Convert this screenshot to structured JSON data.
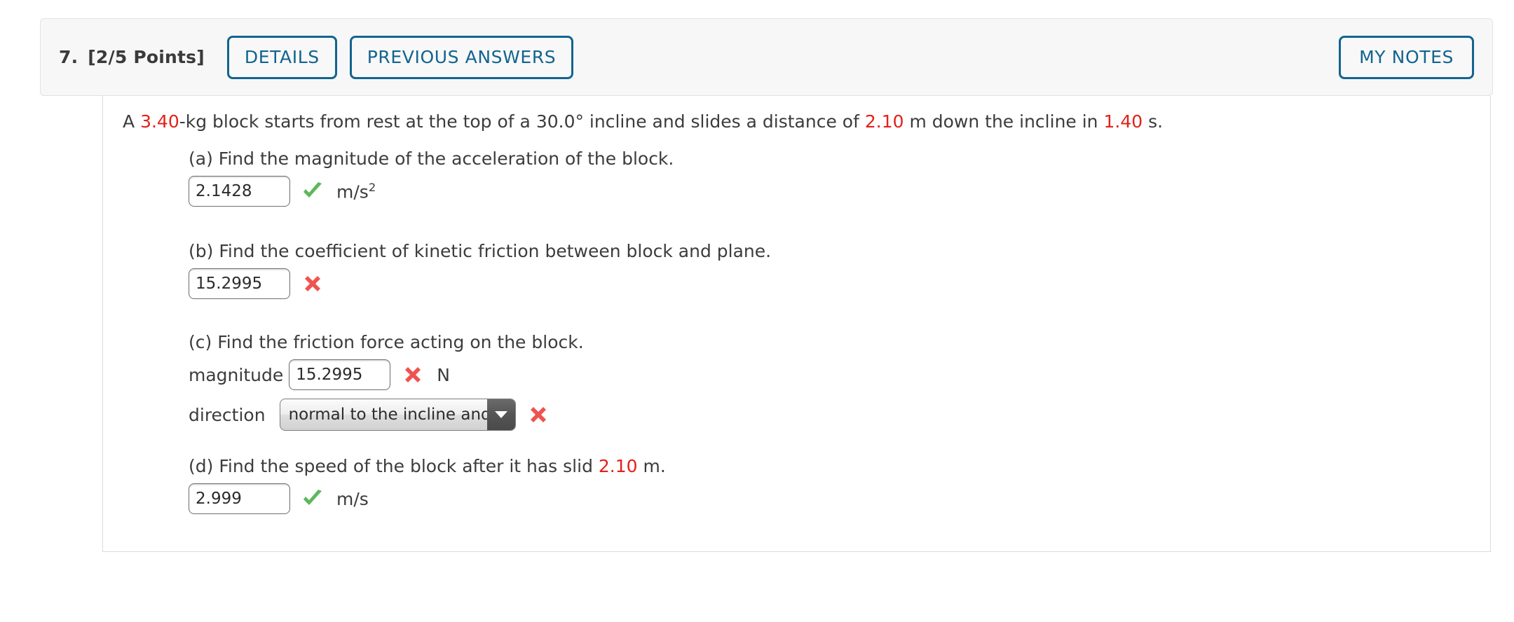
{
  "header": {
    "question_number": "7.",
    "points": "[2/5 Points]",
    "details_label": "DETAILS",
    "previous_answers_label": "PREVIOUS ANSWERS",
    "my_notes_label": "MY NOTES",
    "accent_color": "#12648f",
    "background_color": "#f7f7f7"
  },
  "problem": {
    "stem": {
      "t1": "A ",
      "v1": "3.40",
      "t2": "-kg block starts from rest at the top of a ",
      "v2": "30.0°",
      "t3": " incline and slides a distance of ",
      "v3": "2.10",
      "t4": " m down the incline in ",
      "v4": "1.40",
      "t5": " s."
    },
    "highlight_color": "#e32119",
    "correct_color": "#5cb85c",
    "incorrect_color": "#ef5350"
  },
  "parts": [
    {
      "label": "(a) Find the magnitude of the acceleration of the block.",
      "answer": "2.1428",
      "status": "correct",
      "status_icon": "green-check-icon",
      "unit": "m/s",
      "unit_sup": "2"
    },
    {
      "label": "(b) Find the coefficient of kinetic friction between block and plane.",
      "answer": "15.2995",
      "status": "incorrect",
      "status_icon": "red-x-icon",
      "unit": "",
      "unit_sup": ""
    },
    {
      "label": "(c) Find the friction force acting on the block.",
      "magnitude_label": "magnitude",
      "magnitude_answer": "15.2995",
      "magnitude_status": "incorrect",
      "magnitude_status_icon": "red-x-icon",
      "magnitude_unit": "N",
      "direction_label": "direction",
      "direction_value": "normal to the incline and upward",
      "direction_status": "incorrect",
      "direction_status_icon": "red-x-icon"
    },
    {
      "label_t1": "(d) Find the speed of the block after it has slid ",
      "label_v": "2.10",
      "label_t2": " m.",
      "answer": "2.999",
      "status": "correct",
      "status_icon": "green-check-icon",
      "unit": "m/s",
      "unit_sup": ""
    }
  ]
}
